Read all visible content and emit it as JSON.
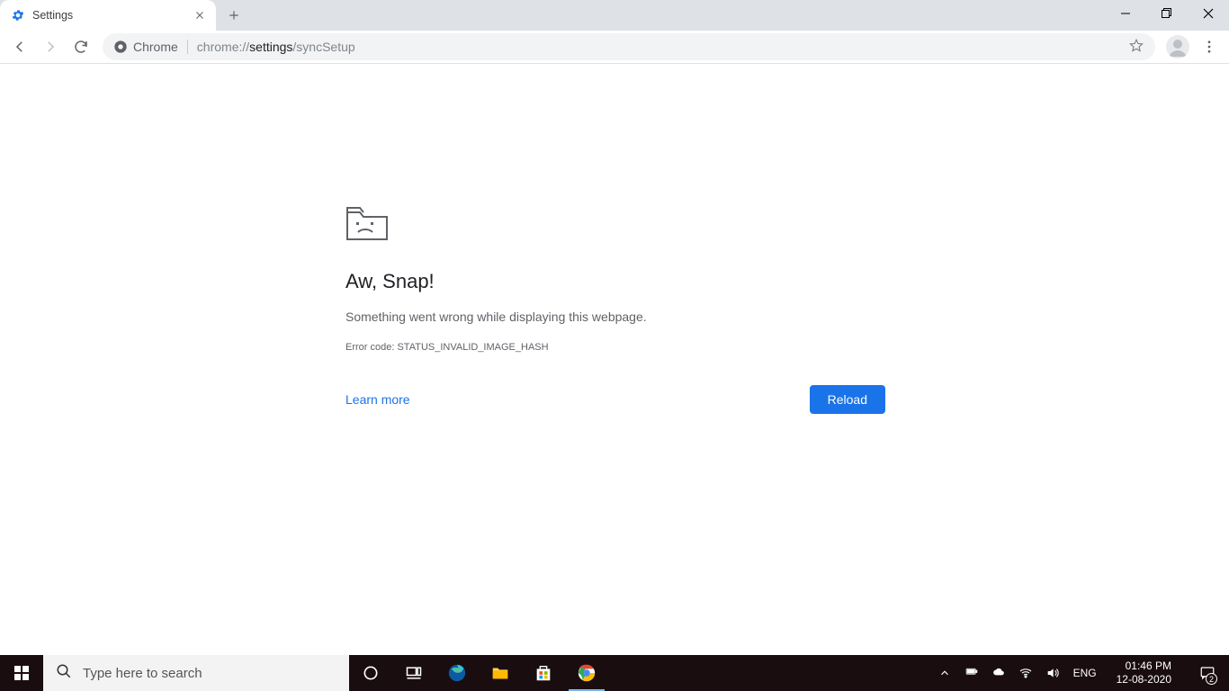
{
  "tab": {
    "title": "Settings"
  },
  "omnibox": {
    "chip_label": "Chrome",
    "url_prefix": "chrome://",
    "url_bold": "settings",
    "url_suffix": "/syncSetup"
  },
  "error": {
    "title": "Aw, Snap!",
    "message": "Something went wrong while displaying this webpage.",
    "code": "Error code: STATUS_INVALID_IMAGE_HASH",
    "learn_more": "Learn more",
    "reload": "Reload"
  },
  "taskbar": {
    "search_placeholder": "Type here to search",
    "lang": "ENG",
    "time": "01:46 PM",
    "date": "12-08-2020",
    "notif_count": "2"
  }
}
